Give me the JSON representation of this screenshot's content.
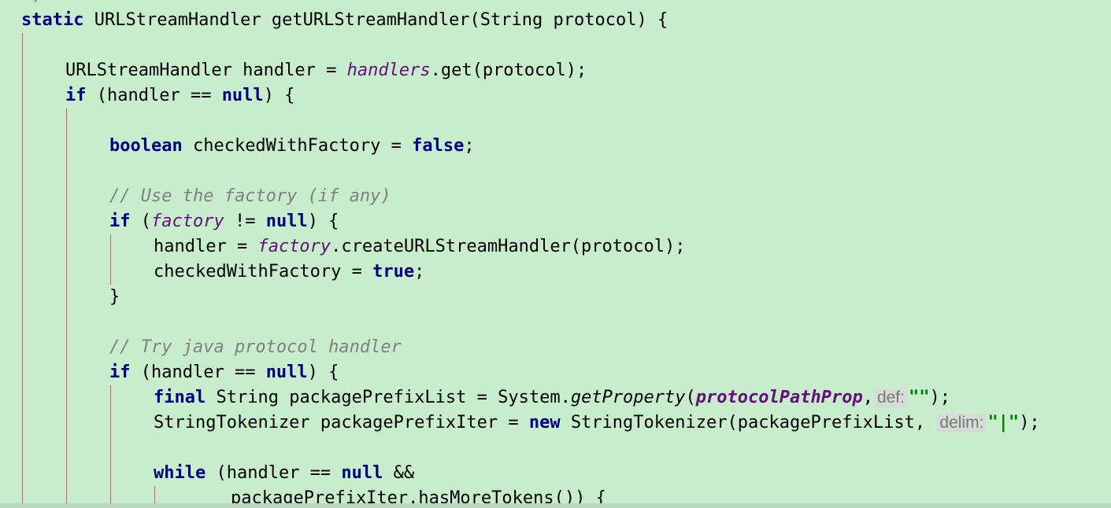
{
  "editor": {
    "top_fragment": "*/",
    "lines": {
      "l0": {
        "kw1": "static",
        "rest": " URLStreamHandler getURLStreamHandler(String protocol) {"
      },
      "l2": {
        "t1": "URLStreamHandler handler = ",
        "field": "handlers",
        "t2": ".get(protocol);"
      },
      "l3": {
        "kw1": "if",
        "t1": " (handler == ",
        "kw2": "null",
        "t2": ") {"
      },
      "l5": {
        "kw1": "boolean",
        "t1": " checkedWithFactory = ",
        "kw2": "false",
        "t2": ";"
      },
      "l7": {
        "comment": "// Use the factory (if any)"
      },
      "l8": {
        "kw1": "if",
        "t1": " (",
        "field": "factory",
        "t2": " != ",
        "kw2": "null",
        "t3": ") {"
      },
      "l9": {
        "t1": "handler = ",
        "field": "factory",
        "t2": ".createURLStreamHandler(protocol);"
      },
      "l10": {
        "t1": "checkedWithFactory = ",
        "kw1": "true",
        "t2": ";"
      },
      "l11": {
        "t1": "}"
      },
      "l13": {
        "comment": "// Try java protocol handler"
      },
      "l14": {
        "kw1": "if",
        "t1": " (handler == ",
        "kw2": "null",
        "t2": ") {"
      },
      "l15": {
        "kw1": "final",
        "t1": " String packagePrefixList = System.",
        "method": "getProperty",
        "t2": "(",
        "sfield": "protocolPathProp",
        "t3": ",",
        "hint": "def:",
        "str": "\"\"",
        "t4": ");"
      },
      "l16": {
        "t1": "StringTokenizer packagePrefixIter = ",
        "kw1": "new",
        "t2": " StringTokenizer(packagePrefixList, ",
        "hint": "delim:",
        "str": "\"|\"",
        "t3": ");"
      },
      "l18": {
        "kw1": "while",
        "t1": " (handler == ",
        "kw2": "null",
        "t2": " &&"
      },
      "l19": {
        "t1": "packagePrefixIter.hasMoreTokens()) {"
      }
    }
  }
}
